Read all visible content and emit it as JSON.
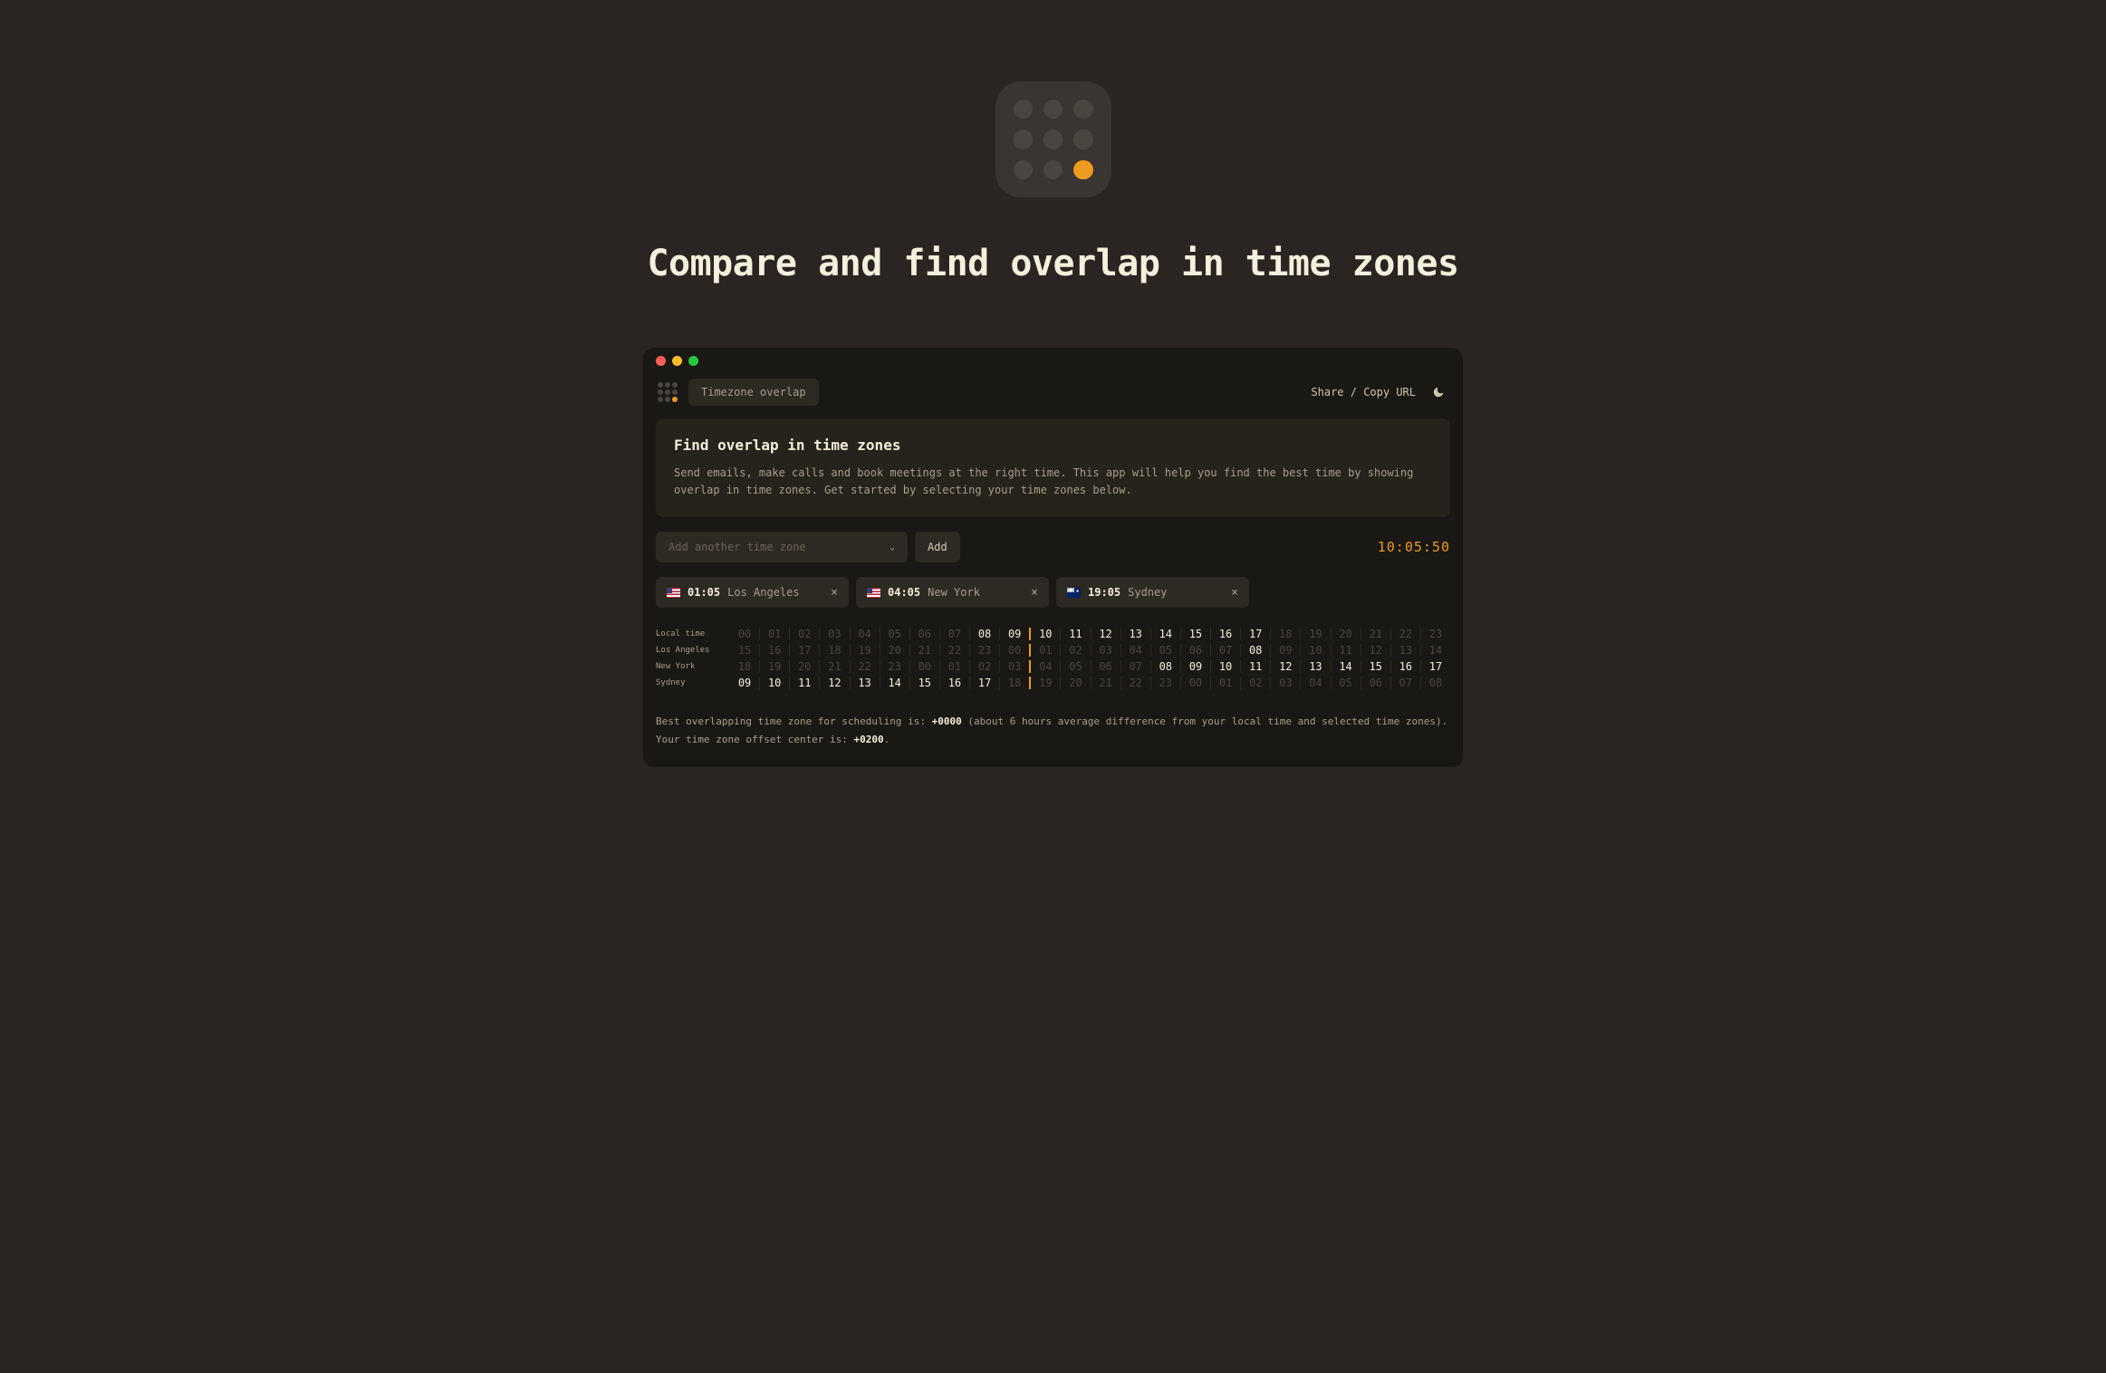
{
  "hero": {
    "title": "Compare and find overlap in time zones"
  },
  "toolbar": {
    "tab_label": "Timezone overlap",
    "share_label": "Share / Copy URL"
  },
  "info": {
    "title": "Find overlap in time zones",
    "body": "Send emails, make calls and book meetings at the right time. This app will help you find the best time by showing overlap in time zones. Get started by selecting your time zones below."
  },
  "add": {
    "placeholder": "Add another time zone",
    "button": "Add"
  },
  "clock": "10:05:50",
  "zones": [
    {
      "flag": "us",
      "time": "01:05",
      "name": "Los Angeles"
    },
    {
      "flag": "us",
      "time": "04:05",
      "name": "New York"
    },
    {
      "flag": "au",
      "time": "19:05",
      "name": "Sydney"
    }
  ],
  "table": {
    "now_index": 10,
    "rows": [
      {
        "label": "Local time",
        "hours": [
          "00",
          "01",
          "02",
          "03",
          "04",
          "05",
          "06",
          "07",
          "08",
          "09",
          "10",
          "11",
          "12",
          "13",
          "14",
          "15",
          "16",
          "17",
          "18",
          "19",
          "20",
          "21",
          "22",
          "23"
        ],
        "work_start": 8,
        "work_end": 17
      },
      {
        "label": "Los Angeles",
        "hours": [
          "15",
          "16",
          "17",
          "18",
          "19",
          "20",
          "21",
          "22",
          "23",
          "00",
          "01",
          "02",
          "03",
          "04",
          "05",
          "06",
          "07",
          "08",
          "09",
          "10",
          "11",
          "12",
          "13",
          "14"
        ],
        "work_start": 17,
        "work_end": 17
      },
      {
        "label": "New York",
        "hours": [
          "18",
          "19",
          "20",
          "21",
          "22",
          "23",
          "00",
          "01",
          "02",
          "03",
          "04",
          "05",
          "06",
          "07",
          "08",
          "09",
          "10",
          "11",
          "12",
          "13",
          "14",
          "15",
          "16",
          "17"
        ],
        "work_start": 14,
        "work_end": 23
      },
      {
        "label": "Sydney",
        "hours": [
          "09",
          "10",
          "11",
          "12",
          "13",
          "14",
          "15",
          "16",
          "17",
          "18",
          "19",
          "20",
          "21",
          "22",
          "23",
          "00",
          "01",
          "02",
          "03",
          "04",
          "05",
          "06",
          "07",
          "08"
        ],
        "work_start": 0,
        "work_end": 8
      }
    ]
  },
  "summary": {
    "line1_pre": "Best overlapping time zone for scheduling is: ",
    "line1_val": "+0000",
    "line1_post": " (about 6 hours average difference from your local time and selected time zones).",
    "line2_pre": "Your time zone offset center is: ",
    "line2_val": "+0200",
    "line2_post": "."
  }
}
